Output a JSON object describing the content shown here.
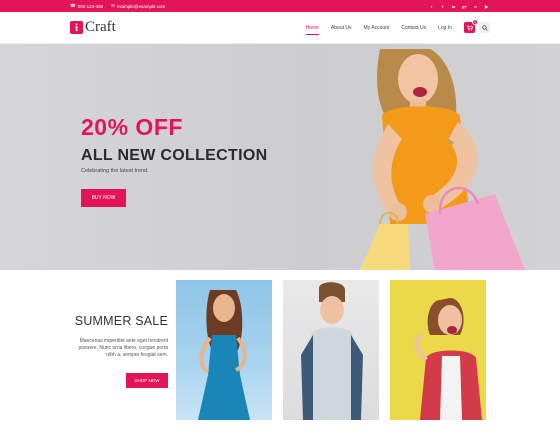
{
  "topbar": {
    "phone": "000-123-456",
    "email": "example@example.com",
    "social_icons": [
      "twitter-icon",
      "facebook-icon",
      "linkedin-icon",
      "google-plus-icon",
      "flickr-icon",
      "youtube-icon"
    ]
  },
  "header": {
    "logo_mark": "i",
    "logo_word": "Craft",
    "nav": [
      {
        "label": "Home",
        "active": true
      },
      {
        "label": "About Us",
        "active": false
      },
      {
        "label": "My Account",
        "active": false
      },
      {
        "label": "Contact Us",
        "active": false
      },
      {
        "label": "Log In",
        "active": false
      }
    ],
    "cart_count": "0"
  },
  "hero": {
    "discount": "20% OFF",
    "headline": "ALL NEW COLLECTION",
    "subtitle": "Celebrating the latest trend.",
    "button": "BUY NOW"
  },
  "sale": {
    "title": "SUMMER SALE",
    "description": "Maecenas imperdiet ante eget hendrerit posuere. Nunc urna libero, congue porta nibh a, semper feugiat sem.",
    "button": "SHOP NOW"
  },
  "colors": {
    "accent": "#e4145a",
    "text_dark": "#2b2b2b"
  }
}
